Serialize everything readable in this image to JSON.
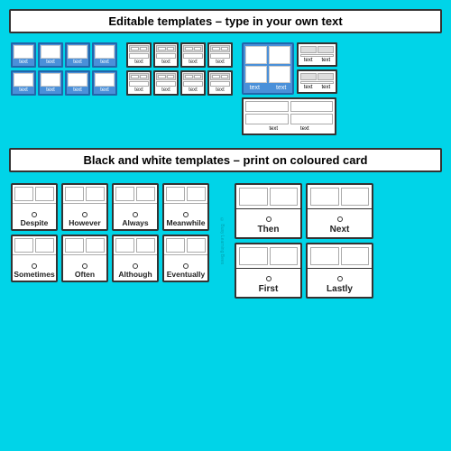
{
  "header1": {
    "text": "Editable templates – type in your own text"
  },
  "header2": {
    "text": "Black and white templates – print on coloured card"
  },
  "blue_cards": {
    "label": "text"
  },
  "bw_row1": [
    {
      "word": "Despite"
    },
    {
      "word": "However"
    },
    {
      "word": "Always"
    },
    {
      "word": "Meanwhile"
    }
  ],
  "bw_row2": [
    {
      "word": "Sometimes"
    },
    {
      "word": "Often"
    },
    {
      "word": "Although"
    },
    {
      "word": "Eventually"
    }
  ],
  "bw_wide_row1": [
    {
      "word": "Then"
    },
    {
      "word": "Next"
    }
  ],
  "bw_wide_row2": [
    {
      "word": "First"
    },
    {
      "word": "Lastly"
    }
  ],
  "credit": "© Busy Learning Bees"
}
